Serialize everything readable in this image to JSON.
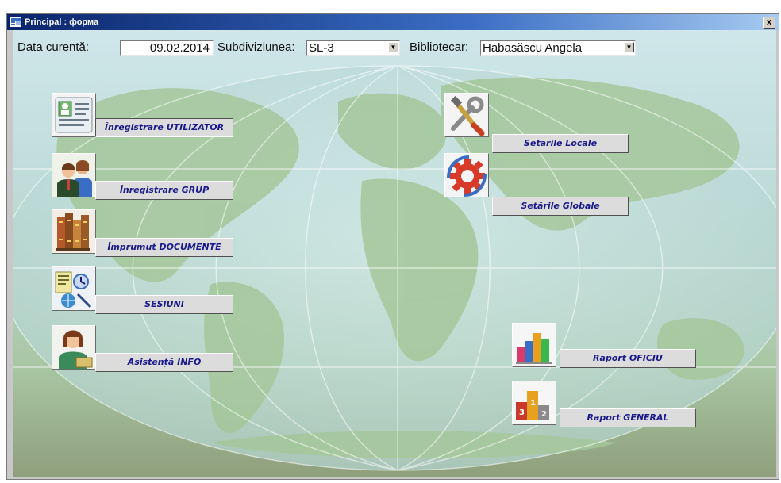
{
  "window": {
    "title": "Principal : форма",
    "close_label": "x"
  },
  "header": {
    "date_label": "Data curentă:",
    "date_value": "09.02.2014",
    "subdivision_label": "Subdiviziunea:",
    "subdivision_value": "SL-3",
    "librarian_label": "Bibliotecar:",
    "librarian_value": "Habasăscu Angela"
  },
  "buttons": {
    "register_user": "Înregistrare UTILIZATOR",
    "register_group": "Înregistrare GRUP",
    "loan_documents": "Împrumut DOCUMENTE",
    "sessions": "SESIUNI",
    "info_assistance": "Asistență INFO",
    "local_settings": "Setările Locale",
    "global_settings": "Setările Globale",
    "office_report": "Raport OFICIU",
    "general_report": "Raport GENERAL"
  },
  "icons": {
    "register_user": "id-card-icon",
    "register_group": "group-icon",
    "loan_documents": "books-icon",
    "sessions": "session-icon",
    "info_assistance": "assistant-icon",
    "local_settings": "tools-icon",
    "global_settings": "gear-icon",
    "office_report": "bar-chart-icon",
    "general_report": "podium-chart-icon"
  },
  "colors": {
    "button_text": "#1a1a8c",
    "titlebar": "#0a246a"
  }
}
